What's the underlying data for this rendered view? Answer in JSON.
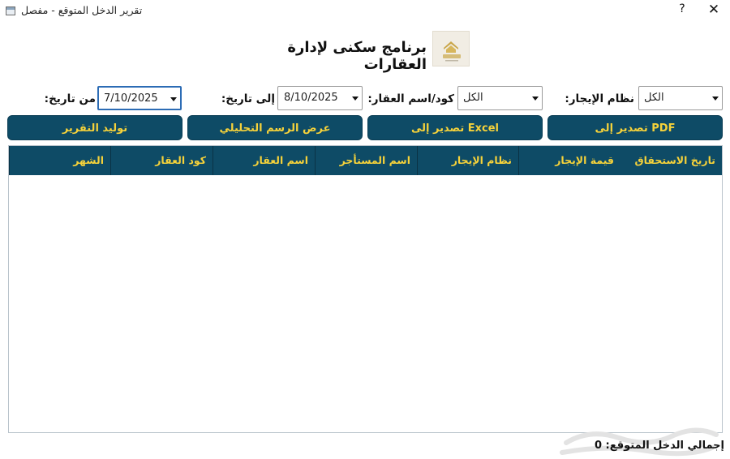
{
  "window": {
    "title": "تقرير الدخل المتوقع - مفصل",
    "help_label": "?",
    "close_label": "✕"
  },
  "header": {
    "app_title": "برنامج سكنى لإدارة العقارات",
    "logo_text": "سكني"
  },
  "filters": {
    "from_date_label": "من تاريخ:",
    "from_date_value": "7/10/2025",
    "to_date_label": "إلى تاريخ:",
    "to_date_value": "8/10/2025",
    "property_label": "كود/اسم العقار:",
    "property_value": "الكل",
    "rent_system_label": "نظام الإيجار:",
    "rent_system_value": "الكل"
  },
  "actions": {
    "export_pdf": "PDF تصدير إلى",
    "export_excel": "Excel تصدير إلى",
    "show_chart": "عرض الرسم التحليلي",
    "generate_report": "توليد التقرير"
  },
  "table": {
    "columns": [
      "تاريخ الاستحقاق",
      "قيمة الإيجار",
      "نظام الإيجار",
      "اسم المستأجر",
      "اسم العقار",
      "كود العقار",
      "الشهر"
    ],
    "rows": []
  },
  "footer": {
    "total_label": "إجمالي الدخل المتوقع: 0"
  },
  "colors": {
    "accent": "#0e4b66",
    "accent_text": "#f6d23a",
    "focus_border": "#2c6cb5"
  }
}
